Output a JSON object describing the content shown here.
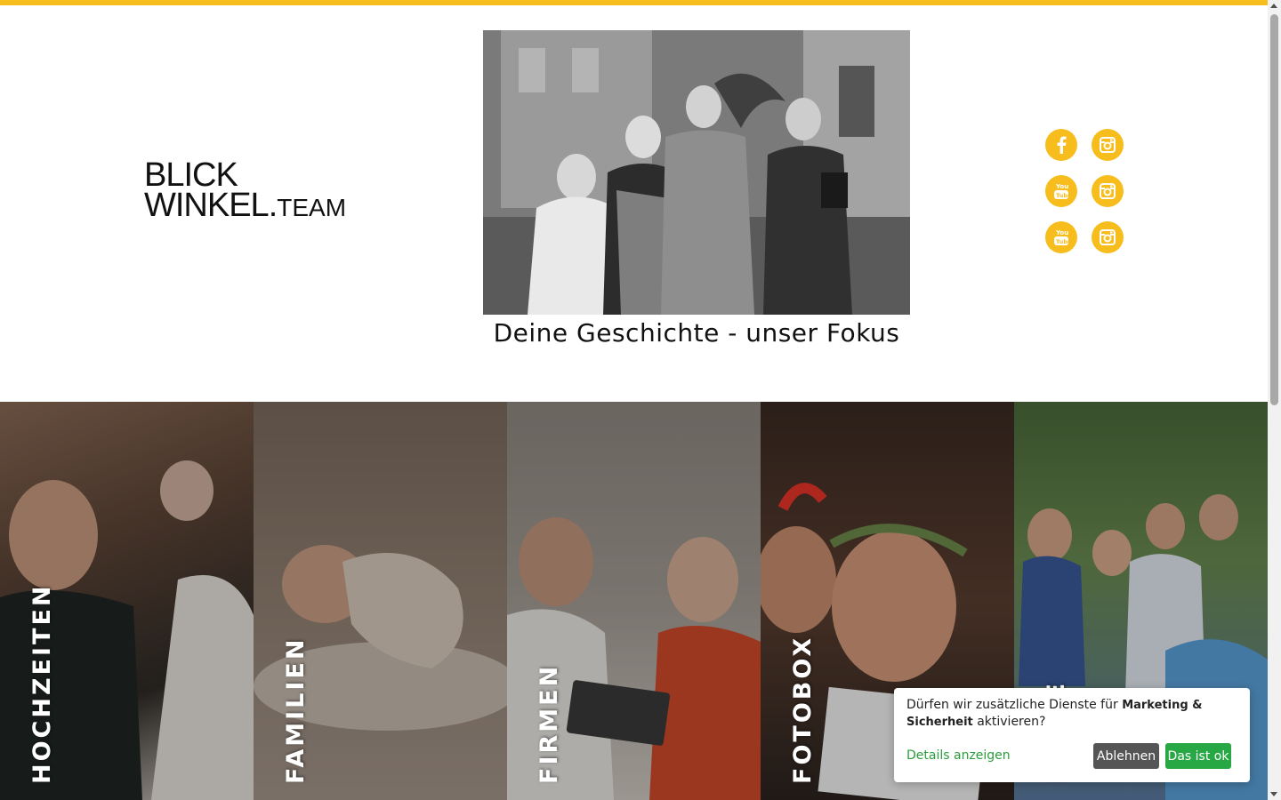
{
  "brand": {
    "logo_line1": "BLICK",
    "logo_line2_main": "WINKEL.",
    "logo_line2_suffix": "TEAM"
  },
  "hero": {
    "tagline": "Deine Geschichte - unser Fokus"
  },
  "social": [
    {
      "icon": "facebook-icon",
      "glyph": "f"
    },
    {
      "icon": "instagram-icon"
    },
    {
      "icon": "youtube-icon"
    },
    {
      "icon": "instagram-icon"
    },
    {
      "icon": "youtube-icon"
    },
    {
      "icon": "instagram-icon"
    }
  ],
  "categories": [
    {
      "label": "HOCHZEITEN"
    },
    {
      "label": "FAMILIEN"
    },
    {
      "label": "FIRMEN"
    },
    {
      "label": "FOTOBOX"
    },
    {
      "label": "KURSE"
    }
  ],
  "cookie": {
    "text_prefix": "Dürfen wir zusätzliche Dienste für ",
    "text_bold": "Marketing & Sicherheit",
    "text_suffix": " aktivieren?",
    "details_label": "Details anzeigen",
    "decline_label": "Ablehnen",
    "accept_label": "Das ist ok"
  },
  "colors": {
    "accent": "#f6bd1c",
    "accept": "#28a745",
    "decline": "#555555"
  }
}
